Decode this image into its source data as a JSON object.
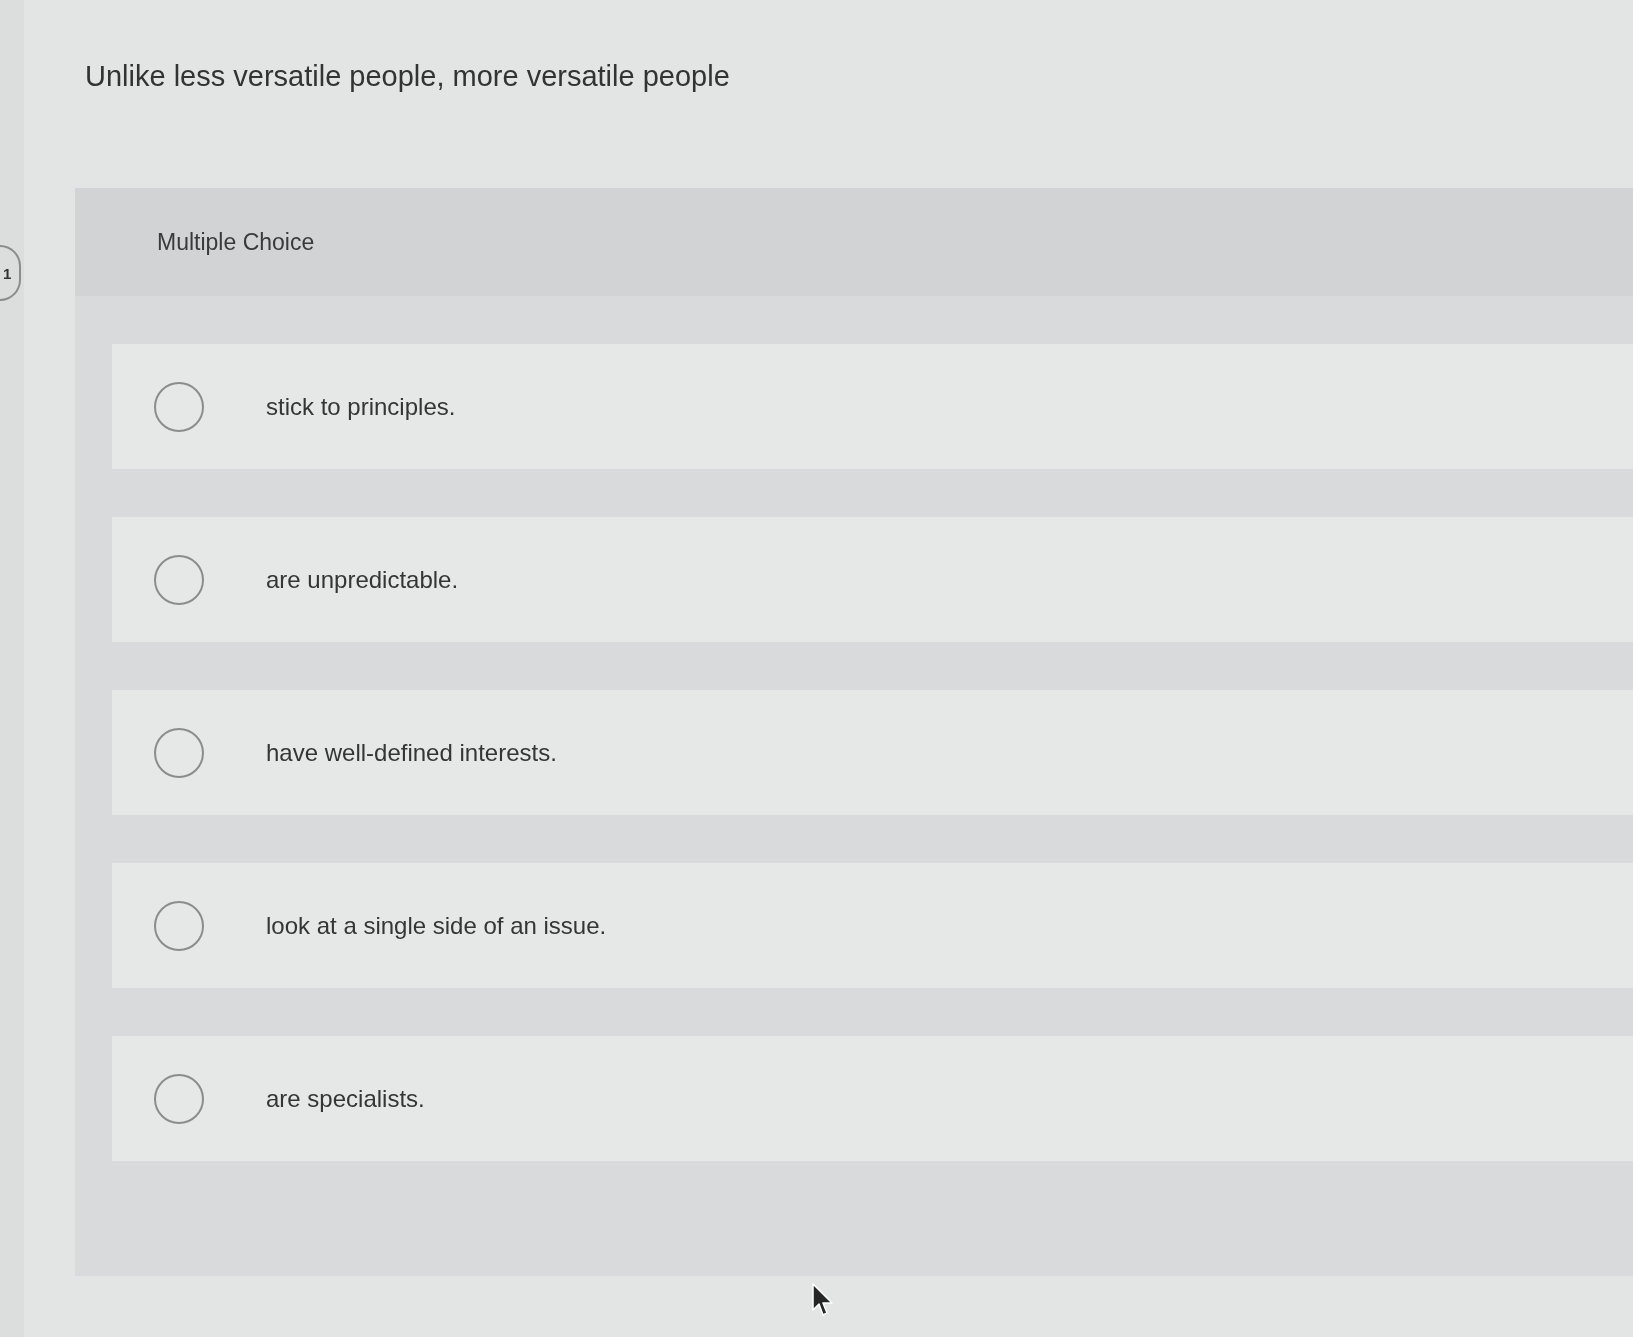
{
  "question_number": "1",
  "question": "Unlike less versatile people, more versatile people",
  "section": {
    "label": "Multiple Choice"
  },
  "choices": [
    {
      "text": "stick to principles.",
      "selected": false
    },
    {
      "text": "are unpredictable.",
      "selected": false
    },
    {
      "text": "have well-defined interests.",
      "selected": false
    },
    {
      "text": "look at a single side of an issue.",
      "selected": false
    },
    {
      "text": "are specialists.",
      "selected": false
    }
  ]
}
